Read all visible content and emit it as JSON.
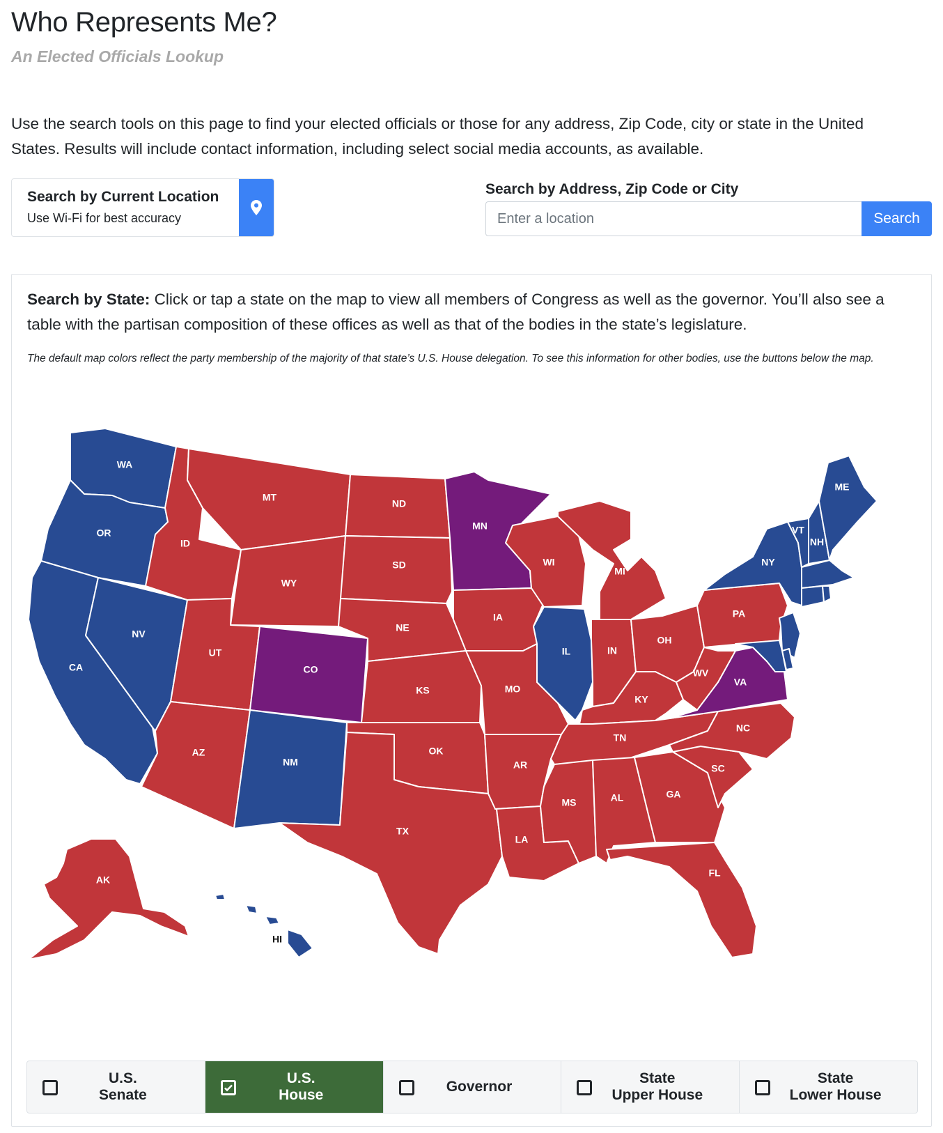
{
  "header": {
    "title": "Who Represents Me?",
    "subtitle": "An Elected Officials Lookup"
  },
  "intro": "Use the search tools on this page to find your elected officials or those for any address, Zip Code, city or state in the United States. Results will include contact information, including select social media accounts, as available.",
  "location_search": {
    "title": "Search by Current Location",
    "subtitle": "Use Wi-Fi for best accuracy",
    "icon": "map-pin-icon"
  },
  "address_search": {
    "label": "Search by Address, Zip Code or City",
    "placeholder": "Enter a location",
    "button_label": "Search"
  },
  "state_search": {
    "heading_bold": "Search by State:",
    "heading_text": " Click or tap a state on the map to view all members of Congress as well as the governor. You’ll also see a table with the partisan composition of these offices as well as that of the bodies in the state’s legislature.",
    "note": "The default map colors reflect the party membership of the majority of that state’s U.S. House delegation. To see this information for other bodies, use the buttons below the map."
  },
  "map": {
    "colors": {
      "democratic": "#284b93",
      "republican": "#c1363a",
      "split": "#741b7b"
    },
    "states": {
      "WA": "democratic",
      "OR": "democratic",
      "CA": "democratic",
      "NV": "democratic",
      "NM": "democratic",
      "HI": "democratic",
      "IL": "democratic",
      "NY": "democratic",
      "ME": "democratic",
      "VT": "democratic",
      "NH": "democratic",
      "MA": "democratic",
      "CT": "democratic",
      "RI": "democratic",
      "NJ": "democratic",
      "MD": "democratic",
      "DE": "democratic",
      "MN": "split",
      "CO": "split",
      "VA": "split",
      "ID": "republican",
      "MT": "republican",
      "WY": "republican",
      "UT": "republican",
      "AZ": "republican",
      "ND": "republican",
      "SD": "republican",
      "NE": "republican",
      "KS": "republican",
      "OK": "republican",
      "TX": "republican",
      "IA": "republican",
      "MO": "republican",
      "AR": "republican",
      "LA": "republican",
      "WI": "republican",
      "MI": "republican",
      "IN": "republican",
      "OH": "republican",
      "KY": "republican",
      "TN": "republican",
      "MS": "republican",
      "AL": "republican",
      "GA": "republican",
      "FL": "republican",
      "SC": "republican",
      "NC": "republican",
      "WV": "republican",
      "PA": "republican",
      "AK": "republican"
    }
  },
  "body_buttons": [
    {
      "label": "U.S.\nSenate",
      "checked": false
    },
    {
      "label": "U.S.\nHouse",
      "checked": true
    },
    {
      "label": "Governor",
      "checked": false
    },
    {
      "label": "State\nUpper House",
      "checked": false
    },
    {
      "label": "State\nLower House",
      "checked": false
    }
  ]
}
